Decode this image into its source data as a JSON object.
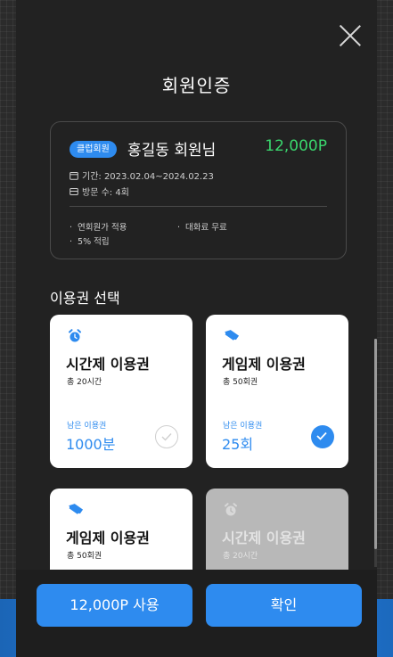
{
  "modal": {
    "title": "회원인증",
    "close_icon": "close-icon"
  },
  "member": {
    "badge": "클럽회원",
    "name": "홍길동 회원님",
    "points": "12,000P",
    "period": "기간: 2023.02.04~2024.02.23",
    "visits": "방문 수: 4회",
    "benefits": [
      "연회원가 적용",
      "대화료 무료",
      "5% 적립"
    ]
  },
  "tickets_section": {
    "title": "이용권 선택",
    "tickets": [
      {
        "icon": "alarm-clock-icon",
        "name": "시간제 이용권",
        "total": "총 20시간",
        "remain_label": "남은 이용권",
        "remain": "1000분",
        "selected": false
      },
      {
        "icon": "ticket-icon",
        "name": "게임제 이용권",
        "total": "총 50회권",
        "remain_label": "남은 이용권",
        "remain": "25회",
        "selected": true
      },
      {
        "icon": "ticket-icon",
        "name": "게임제 이용권",
        "total": "총 50회권"
      },
      {
        "icon": "alarm-clock-icon",
        "name": "시간제 이용권",
        "total": "총 20시간",
        "disabled": true
      }
    ]
  },
  "footer": {
    "use_points_label": "12,000P 사용",
    "confirm_label": "확인"
  },
  "colors": {
    "accent": "#2e8bef",
    "points": "#3ad66d",
    "modal_bg": "#222222"
  }
}
